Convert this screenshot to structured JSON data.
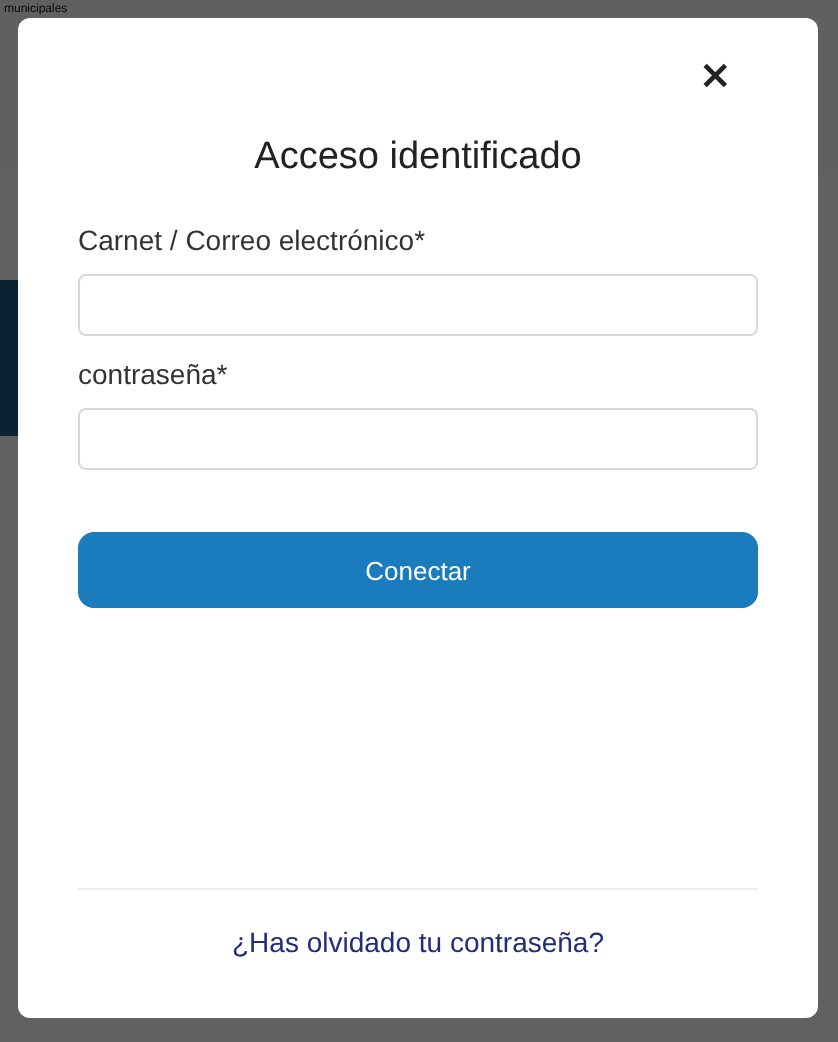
{
  "background": {
    "logo_text": "municipales"
  },
  "dialog": {
    "title": "Acceso identificado",
    "close": "×",
    "fields": [
      {
        "label": "Carnet / Correo electrónico*"
      },
      {
        "label": "contraseña*"
      }
    ],
    "submit": "Conectar",
    "forgot_link": "¿Has olvidado tu contraseña?"
  }
}
